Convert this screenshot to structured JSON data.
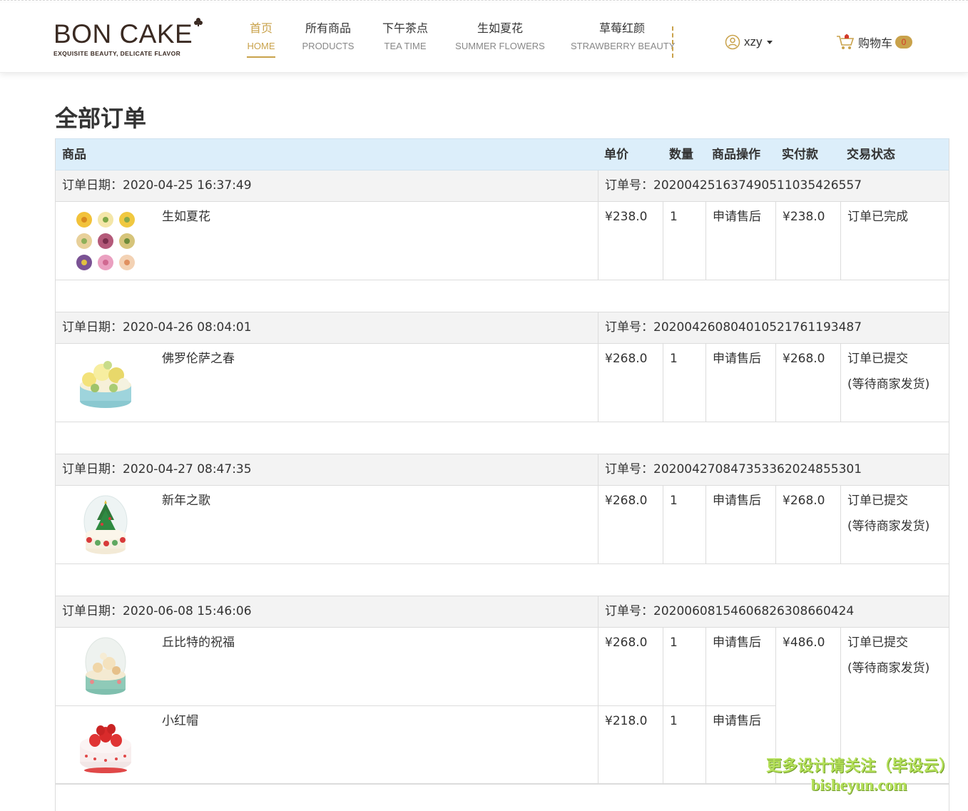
{
  "brand": {
    "name": "BON CAKE",
    "tagline": "EXQUISITE BEAUTY, DELICATE FLAVOR"
  },
  "nav": [
    {
      "cn": "首页",
      "en": "HOME",
      "active": true
    },
    {
      "cn": "所有商品",
      "en": "PRODUCTS"
    },
    {
      "cn": "下午茶点",
      "en": "TEA TIME"
    },
    {
      "cn": "生如夏花",
      "en": "SUMMER FLOWERS"
    },
    {
      "cn": "草莓红颜",
      "en": "STRAWBERRY BEAUTY"
    }
  ],
  "user": {
    "name": "xzy",
    "icon": "user-circle-icon"
  },
  "cart": {
    "label": "购物车",
    "count": "0",
    "icon": "shopping-cart-icon"
  },
  "page": {
    "title": "全部订单"
  },
  "table": {
    "headers": {
      "product": "商品",
      "price": "单价",
      "qty": "数量",
      "action": "商品操作",
      "paid": "实付款",
      "status": "交易状态"
    },
    "orders": [
      {
        "date_label": "订单日期：2020-04-25 16:37:49",
        "no_label": "订单号：20200425163749051103542655​7",
        "items": [
          {
            "name": "生如夏花",
            "price": "¥238.0",
            "qty": "1",
            "action": "申请售后",
            "image": "flower-cupcakes"
          }
        ],
        "paid": "¥238.0",
        "status": "订单已完成",
        "status_note": ""
      },
      {
        "date_label": "订单日期：2020-04-26 08:04:01",
        "no_label": "订单号：20200426080401052176119348​7",
        "items": [
          {
            "name": "佛罗伦萨之春",
            "price": "¥268.0",
            "qty": "1",
            "action": "申请售后",
            "image": "flower-cake"
          }
        ],
        "paid": "¥268.0",
        "status": "订单已提交",
        "status_note": "(等待商家发货)"
      },
      {
        "date_label": "订单日期：2020-04-27 08:47:35",
        "no_label": "订单号：20200427084735336202485530​1",
        "items": [
          {
            "name": "新年之歌",
            "price": "¥268.0",
            "qty": "1",
            "action": "申请售后",
            "image": "xmas-cake"
          }
        ],
        "paid": "¥268.0",
        "status": "订单已提交",
        "status_note": "(等待商家发货)"
      },
      {
        "date_label": "订单日期：2020-06-08 15:46:06",
        "no_label": "订单号：20200608154606826308660424",
        "items": [
          {
            "name": "丘比特的祝福",
            "price": "¥268.0",
            "qty": "1",
            "action": "申请售后",
            "image": "dome-cake"
          },
          {
            "name": "小红帽",
            "price": "¥218.0",
            "qty": "1",
            "action": "申请售后",
            "image": "strawberry-cake"
          }
        ],
        "paid": "¥486.0",
        "status": "订单已提交",
        "status_note": "(等待商家发货)"
      }
    ]
  },
  "watermark": {
    "line1": "更多设计请关注（毕设云）",
    "line2": "bisheyun.com"
  }
}
